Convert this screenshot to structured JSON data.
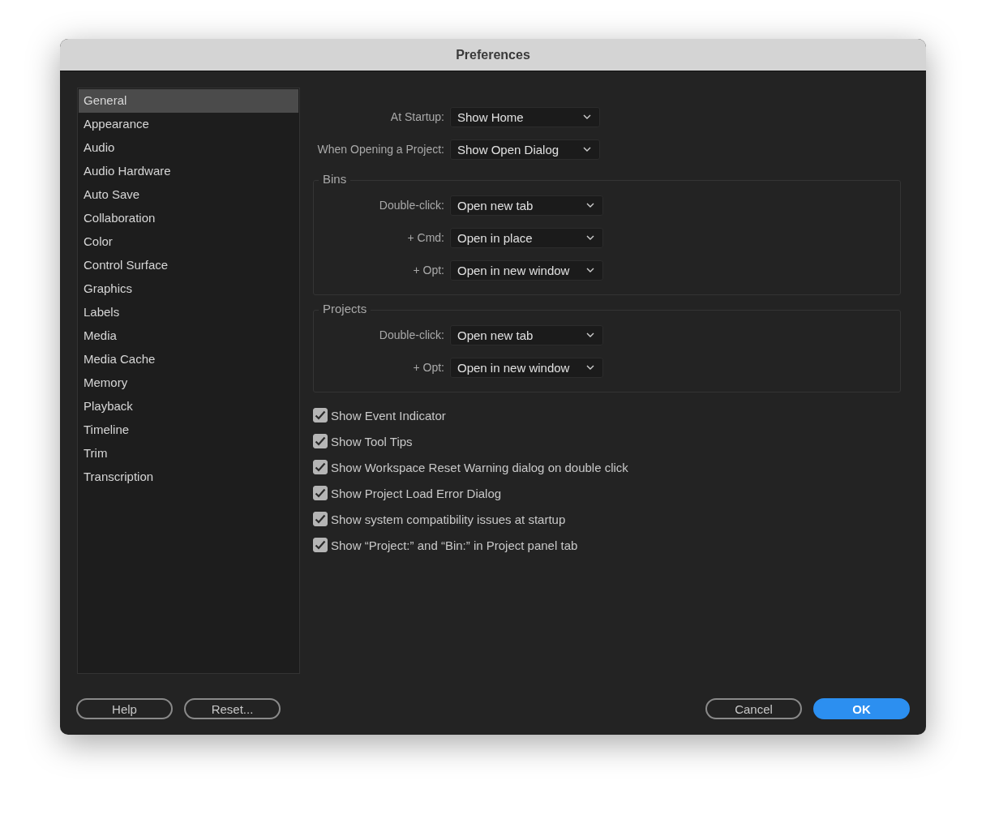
{
  "window": {
    "title": "Preferences"
  },
  "sidebar": {
    "items": [
      {
        "label": "General",
        "selected": true
      },
      {
        "label": "Appearance",
        "selected": false
      },
      {
        "label": "Audio",
        "selected": false
      },
      {
        "label": "Audio Hardware",
        "selected": false
      },
      {
        "label": "Auto Save",
        "selected": false
      },
      {
        "label": "Collaboration",
        "selected": false
      },
      {
        "label": "Color",
        "selected": false
      },
      {
        "label": "Control Surface",
        "selected": false
      },
      {
        "label": "Graphics",
        "selected": false
      },
      {
        "label": "Labels",
        "selected": false
      },
      {
        "label": "Media",
        "selected": false
      },
      {
        "label": "Media Cache",
        "selected": false
      },
      {
        "label": "Memory",
        "selected": false
      },
      {
        "label": "Playback",
        "selected": false
      },
      {
        "label": "Timeline",
        "selected": false
      },
      {
        "label": "Trim",
        "selected": false
      },
      {
        "label": "Transcription",
        "selected": false
      }
    ]
  },
  "settings": [
    {
      "label": "At Startup:",
      "value": "Show Home"
    },
    {
      "label": "When Opening a Project:",
      "value": "Show Open Dialog"
    }
  ],
  "groups": [
    {
      "title": "Bins",
      "rows": [
        {
          "label": "Double-click:",
          "value": "Open new tab"
        },
        {
          "label": "+ Cmd:",
          "value": "Open in place"
        },
        {
          "label": "+ Opt:",
          "value": "Open in new window"
        }
      ]
    },
    {
      "title": "Projects",
      "rows": [
        {
          "label": "Double-click:",
          "value": "Open new tab"
        },
        {
          "label": "+ Opt:",
          "value": "Open in new window"
        }
      ]
    }
  ],
  "checkboxes": [
    {
      "label": "Show Event Indicator",
      "checked": true
    },
    {
      "label": "Show Tool Tips",
      "checked": true
    },
    {
      "label": "Show Workspace Reset Warning dialog on double click",
      "checked": true
    },
    {
      "label": "Show Project Load Error Dialog",
      "checked": true
    },
    {
      "label": "Show system compatibility issues at startup",
      "checked": true
    },
    {
      "label": "Show “Project:” and “Bin:” in Project panel tab",
      "checked": true
    }
  ],
  "footer": {
    "left_buttons": [
      {
        "label": "Help",
        "kind": "secondary"
      },
      {
        "label": "Reset...",
        "kind": "secondary"
      }
    ],
    "right_buttons": [
      {
        "label": "Cancel",
        "kind": "secondary"
      },
      {
        "label": "OK",
        "kind": "primary"
      }
    ]
  }
}
